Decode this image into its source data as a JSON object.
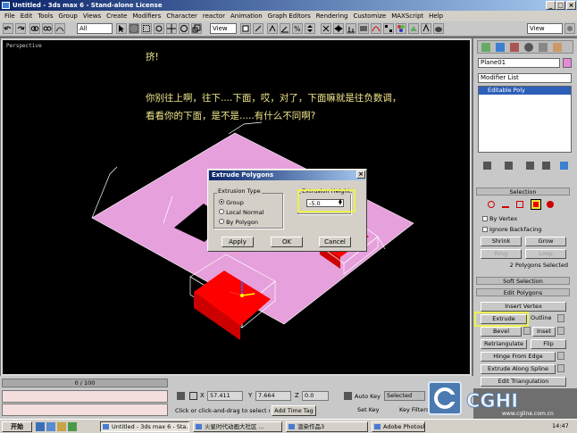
{
  "window": {
    "title": "Untitled - 3ds max 6 - Stand-alone License"
  },
  "menu": [
    "File",
    "Edit",
    "Tools",
    "Group",
    "Views",
    "Create",
    "Modifiers",
    "Character",
    "reactor",
    "Animation",
    "Graph Editors",
    "Rendering",
    "Customize",
    "MAXScript",
    "Help"
  ],
  "toolbar": {
    "filter": "All",
    "view_ref": "View",
    "view_ref2": "View"
  },
  "viewport": {
    "label": "Perspective",
    "note_line1": "挤!",
    "note_line2": "你别往上啊，往下....下面，哎，对了，下面嘛就是往负数调，",
    "note_line3": "看看你的下面，是不是.....有什么不同啊?"
  },
  "dialog": {
    "title": "Extrude Polygons",
    "type_label": "Extrusion Type",
    "options": [
      "Group",
      "Local Normal",
      "By Polygon"
    ],
    "selected_option": "Group",
    "height_label": "Extrusion Height:",
    "height_value": "-5.0",
    "apply": "Apply",
    "ok": "OK",
    "cancel": "Cancel"
  },
  "panel": {
    "object_name": "Plane01",
    "modifier_list": "Modifier List",
    "stack_item": "Editable Poly",
    "selection_title": "Selection",
    "by_vertex": "By Vertex",
    "ignore_backfacing": "Ignore Backfacing",
    "shrink": "Shrink",
    "grow": "Grow",
    "ring": "Ring",
    "loop": "Loop",
    "selected_status": "2 Polygons Selected",
    "soft_selection": "Soft Selection",
    "edit_polygons": "Edit Polygons",
    "insert_vertex": "Insert Vertex",
    "extrude": "Extrude",
    "outline": "Outline",
    "bevel": "Bevel",
    "inset": "Inset",
    "retriangulate": "Retriangulate",
    "flip": "Flip",
    "hinge": "Hinge From Edge",
    "extrude_spline": "Extrude Along Spline",
    "edit_triangulation": "Edit Triangulation"
  },
  "status": {
    "frame": "0 / 100",
    "x": "57.411",
    "y": "7.664",
    "z": "0.0",
    "prompt": "Click or click-and-drag to select obj",
    "add_time_tag": "Add Time Tag",
    "auto_key": "Auto Key",
    "set_key": "Set Key",
    "selected": "Selected",
    "key_filters": "Key Filters..."
  },
  "taskbar": {
    "start": "开始",
    "tasks": [
      "Untitled - 3ds max 6 - Sta...",
      "火星时代动画大社区 ...",
      "渲染作品3",
      "Adobe Photoshop"
    ],
    "clock": "14:47"
  },
  "watermark": {
    "brand": "CGHI",
    "url": "www.cgline.com.cn"
  }
}
